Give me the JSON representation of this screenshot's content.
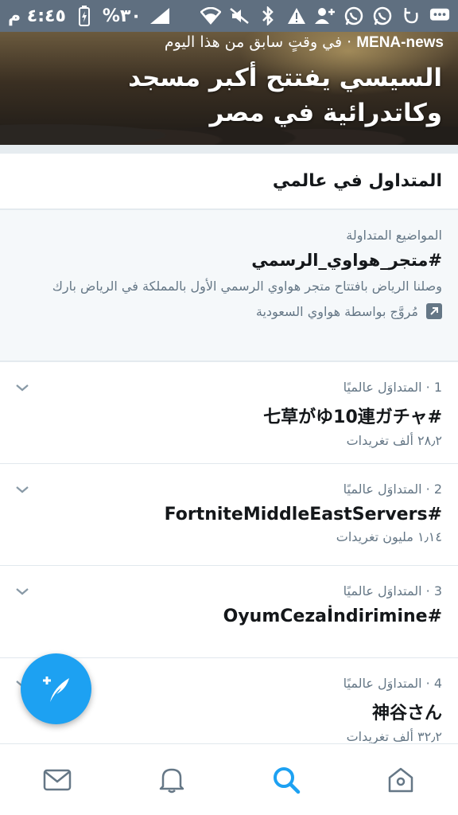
{
  "status_bar": {
    "time": "٤:٤٥ م",
    "battery": "%٣٠",
    "icons": [
      "signal-icon",
      "battery-icon",
      "wifi-icon",
      "mute-icon",
      "bluetooth-icon",
      "alert-icon",
      "add-contact-icon",
      "whatsapp-icon",
      "whatsapp-icon",
      "refresh-icon",
      "message-icon"
    ]
  },
  "hero": {
    "source": "MENA-news",
    "time_text": " · في وقتٍ سابق من هذا اليوم",
    "title": "السيسي يفتتح أكبر مسجد وكاتدرائية في مصر"
  },
  "section": {
    "title": "المتداول في عالمي"
  },
  "promoted": {
    "label": "المواضيع المتداولة",
    "hashtag": "#متجر_هواوي_الرسمي",
    "description": "وصلنا الرياض بافتتاح متجر هواوي الرسمي الأول بالمملكة في الرياض بارك",
    "promoted_by": "مُروَّج بواسطة هواوي السعودية"
  },
  "trends": [
    {
      "rank": "1",
      "meta": "1 · المتداوَل عالميًا",
      "name": "#七草がゆ10連ガチャ",
      "count": "٢٨٫٢ ألف تغريدات"
    },
    {
      "rank": "2",
      "meta": "2 · المتداوَل عالميًا",
      "name": "#FortniteMiddleEastServers",
      "count": "١٫١٤ مليون تغريدات"
    },
    {
      "rank": "3",
      "meta": "3 · المتداوَل عالميًا",
      "name": "#OyumCezaİndirimine",
      "count": ""
    },
    {
      "rank": "4",
      "meta": "4 · المتداوَل عالميًا",
      "name": "神谷さん",
      "count": "٣٢٫٢ ألف تغريدات"
    }
  ],
  "colors": {
    "accent": "#1da1f2",
    "status_bar": "#5f6f80",
    "muted_text": "#657786",
    "primary_text": "#14171a"
  },
  "bottom_nav": [
    "mail-icon",
    "bell-icon",
    "search-icon",
    "home-icon"
  ]
}
